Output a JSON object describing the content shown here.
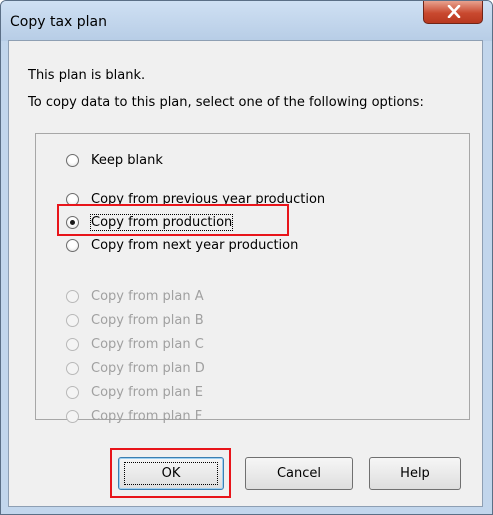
{
  "window": {
    "title": "Copy tax plan",
    "close_icon": "close-icon"
  },
  "message": {
    "line1": "This plan is blank.",
    "line2": "To copy data to this plan, select one of the following options:"
  },
  "options": [
    {
      "label": "Keep blank",
      "checked": false,
      "enabled": true
    },
    {
      "label": "Copy from previous year production",
      "checked": false,
      "enabled": true
    },
    {
      "label": "Copy from production",
      "checked": true,
      "enabled": true
    },
    {
      "label": "Copy from next year production",
      "checked": false,
      "enabled": true
    },
    {
      "label": "Copy from plan A",
      "checked": false,
      "enabled": false
    },
    {
      "label": "Copy from plan B",
      "checked": false,
      "enabled": false
    },
    {
      "label": "Copy from plan C",
      "checked": false,
      "enabled": false
    },
    {
      "label": "Copy from plan D",
      "checked": false,
      "enabled": false
    },
    {
      "label": "Copy from plan E",
      "checked": false,
      "enabled": false
    },
    {
      "label": "Copy from plan F",
      "checked": false,
      "enabled": false
    }
  ],
  "buttons": {
    "ok": "OK",
    "cancel": "Cancel",
    "help": "Help"
  },
  "colors": {
    "highlight": "#e8141a",
    "title_bar": "#c2d6ec",
    "close_button": "#c9492f"
  }
}
